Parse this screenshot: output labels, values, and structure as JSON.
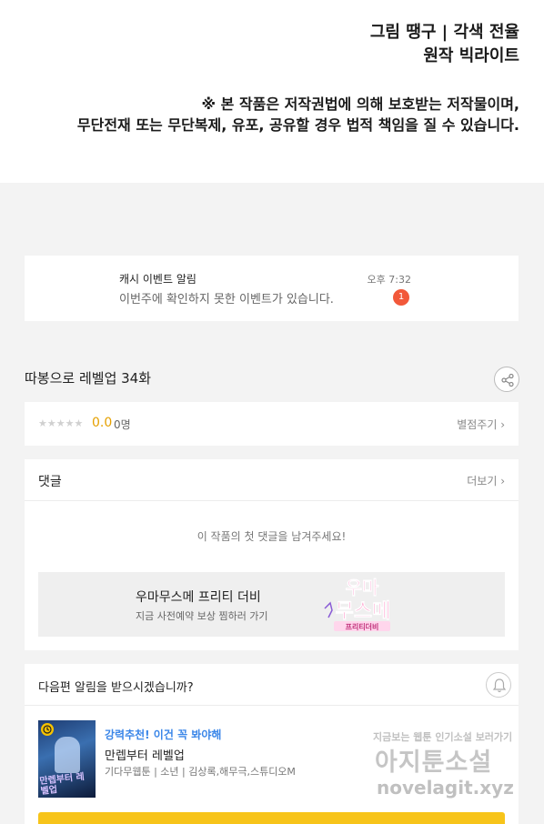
{
  "credits": {
    "line1": "그림 땡구 | 각색 전율",
    "line2": "원작 빅라이트",
    "line3": "※ 본 작품은 저작권법에 의해 보호받는 저작물이며,",
    "line4": "무단전재 또는 무단복제, 유포, 공유할 경우 법적 책임을 질 수 있습니다."
  },
  "notice": {
    "title": "캐시 이벤트 알림",
    "desc": "이번주에 확인하지 못한 이벤트가 있습니다.",
    "time": "오후 7:32",
    "count": "1"
  },
  "episode": {
    "title": "따봉으로 레벨업 34화",
    "share_icon": "share-icon"
  },
  "rating": {
    "stars": "★★★★★",
    "score": "0.0",
    "people": "0명",
    "rate_link": "별점주기 ›"
  },
  "comments": {
    "title": "댓글",
    "more": "더보기 ›",
    "empty": "이 작품의 첫 댓글을 남겨주세요!",
    "promo_title": "우마무스메 프리티 더비",
    "promo_sub": "지금 사전예약 보상 찜하러 가기",
    "promo_logo": "우마무스메",
    "promo_logo_sub": "프리티더비"
  },
  "subscribe": {
    "question": "다음편 알림을 받으시겠습니까?",
    "rec_tag": "강력추천! 이건 꼭 봐야해",
    "rec_title": "만렙부터 레벨업",
    "rec_meta": "기다무웹툰 | 소년 | 김상록,해무극,스튜디오M",
    "thumb_title": "만렙부터 레벨업"
  },
  "watermark": {
    "line1": "지금보는 웹툰 인기소설 보러가기",
    "line2": "아지툰소설",
    "line3": "novelagit.xyz"
  },
  "colors": {
    "accent_yellow": "#f7c41a",
    "badge_red": "#f2583a",
    "score_gold": "#e5a000",
    "link_blue": "#3a86e8"
  }
}
